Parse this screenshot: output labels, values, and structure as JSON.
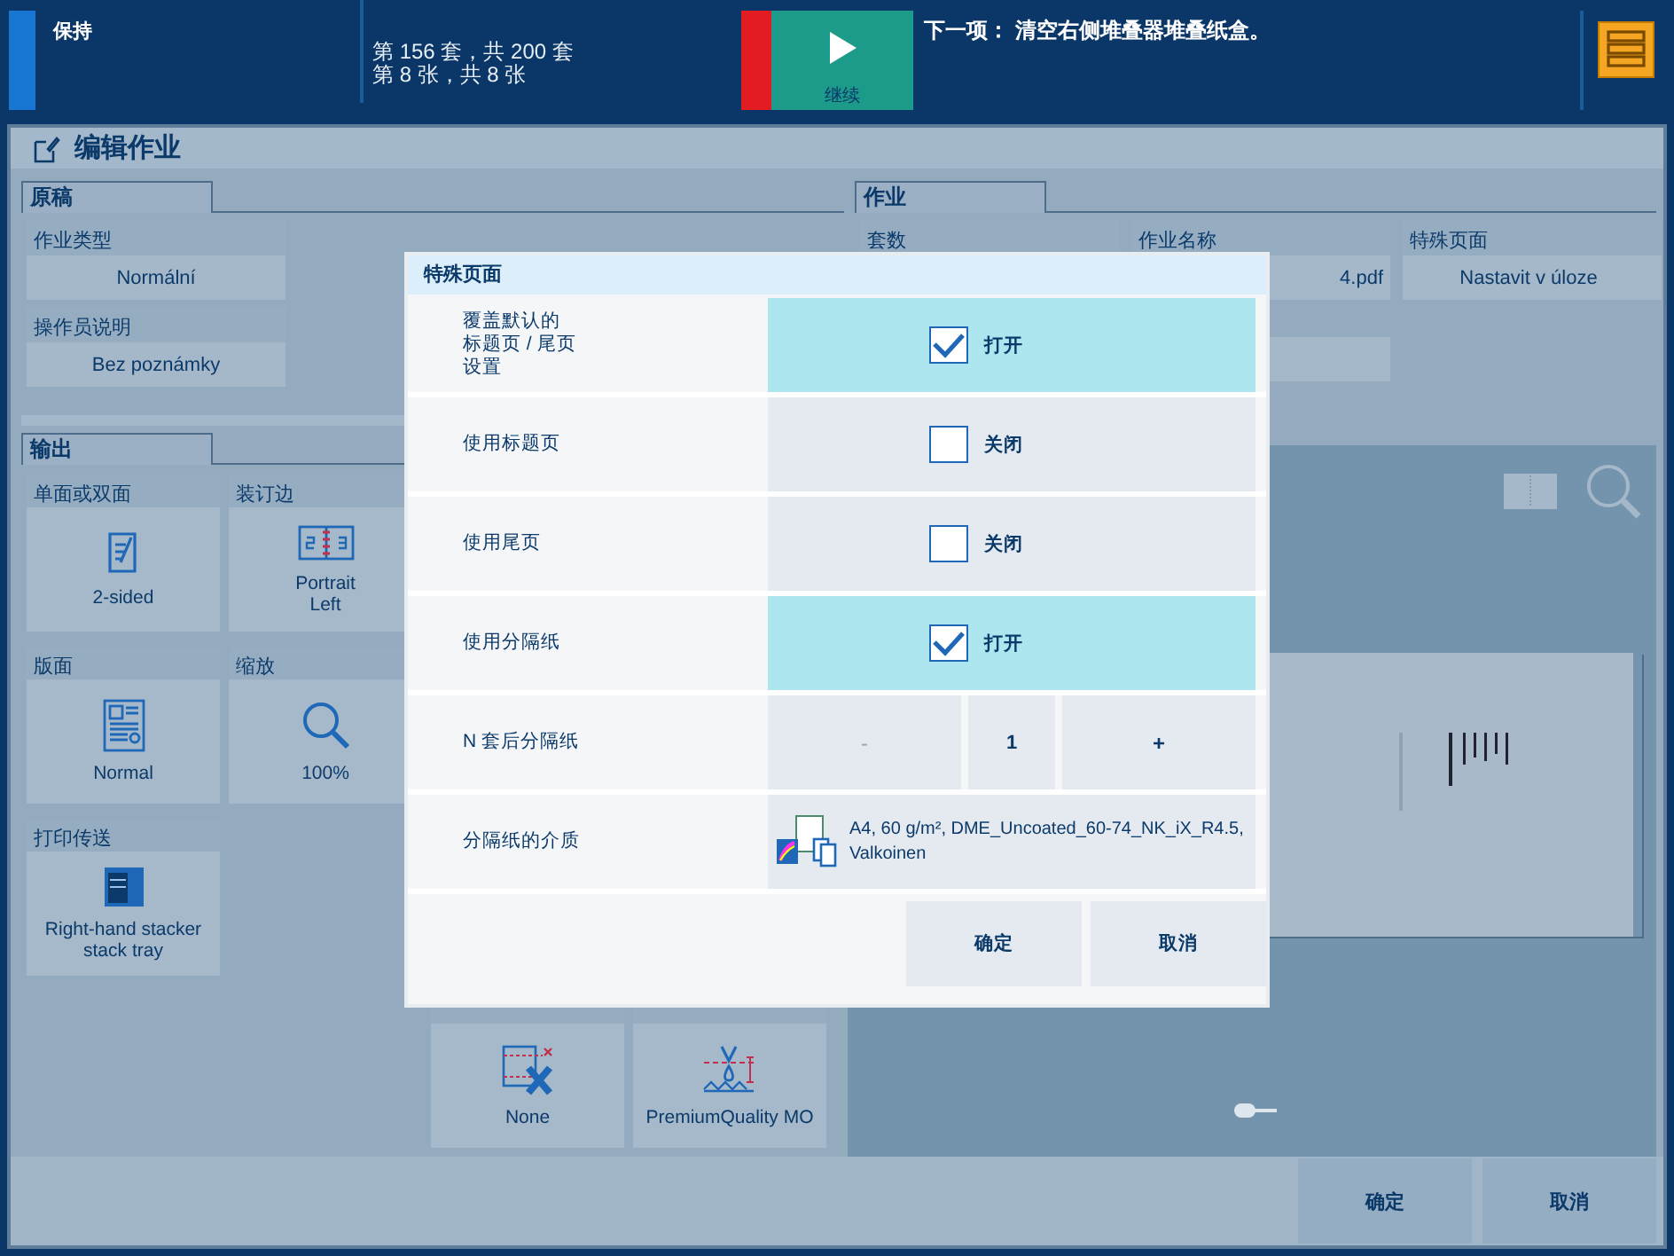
{
  "status_bar": {
    "state": "保持",
    "sets": "第 156 套，共 200 套",
    "sheets": "第 8 张，共 8 张",
    "continue_label": "继续",
    "next_step": "下一项： 清空右侧堆叠器堆叠纸盒。"
  },
  "window": {
    "title": "编辑作业"
  },
  "original_section": {
    "tab": "原稿",
    "fields": [
      {
        "label": "作业类型",
        "value": "Normální"
      },
      {
        "label": "操作员说明",
        "value": "Bez poznámky"
      }
    ]
  },
  "job_section": {
    "tab": "作业",
    "fields": [
      {
        "label": "套数"
      },
      {
        "label": "作业名称",
        "value": "4.pdf"
      },
      {
        "label": "特殊页面",
        "value": "Nastavit v úloze"
      }
    ]
  },
  "output_section": {
    "tab": "输出",
    "tiles": [
      {
        "kind": "duplex",
        "label": "单面或双面",
        "value": "2-sided"
      },
      {
        "kind": "binding",
        "label": "装订边",
        "value": "Portrait\nLeft"
      },
      {
        "kind": "layout",
        "label": "版面",
        "value": "Normal"
      },
      {
        "kind": "zoom",
        "label": "缩放",
        "value": "100%"
      },
      {
        "kind": "delivery",
        "label": "打印传送",
        "value": "Right-hand stacker\nstack tray"
      },
      {
        "kind": "trim",
        "value": "None"
      },
      {
        "kind": "print_mode",
        "value": "PremiumQuality MO"
      }
    ]
  },
  "dialog": {
    "title": "特殊页面",
    "rows": [
      {
        "kind": "checkbox",
        "label_lines": [
          "覆盖默认的",
          "标题页 / 尾页",
          "设置"
        ],
        "checked": true,
        "state_text": "打开"
      },
      {
        "kind": "checkbox",
        "label": "使用标题页",
        "checked": false,
        "state_text": "关闭"
      },
      {
        "kind": "checkbox",
        "label": "使用尾页",
        "checked": false,
        "state_text": "关闭"
      },
      {
        "kind": "checkbox",
        "label": "使用分隔纸",
        "checked": true,
        "state_text": "打开"
      },
      {
        "kind": "stepper",
        "label": "N 套后分隔纸",
        "decrement": {
          "text": "-",
          "disabled": true
        },
        "value": "1",
        "increment": {
          "text": "+",
          "disabled": false
        }
      },
      {
        "kind": "media",
        "label": "分隔纸的介质",
        "value": "A4, 60 g/m², DME_Uncoated_60-74_NK_iX_R4.5,\nValkoinen"
      }
    ],
    "buttons": [
      "确定",
      "取消"
    ]
  },
  "footer": {
    "buttons": [
      "确定",
      "取消"
    ]
  }
}
